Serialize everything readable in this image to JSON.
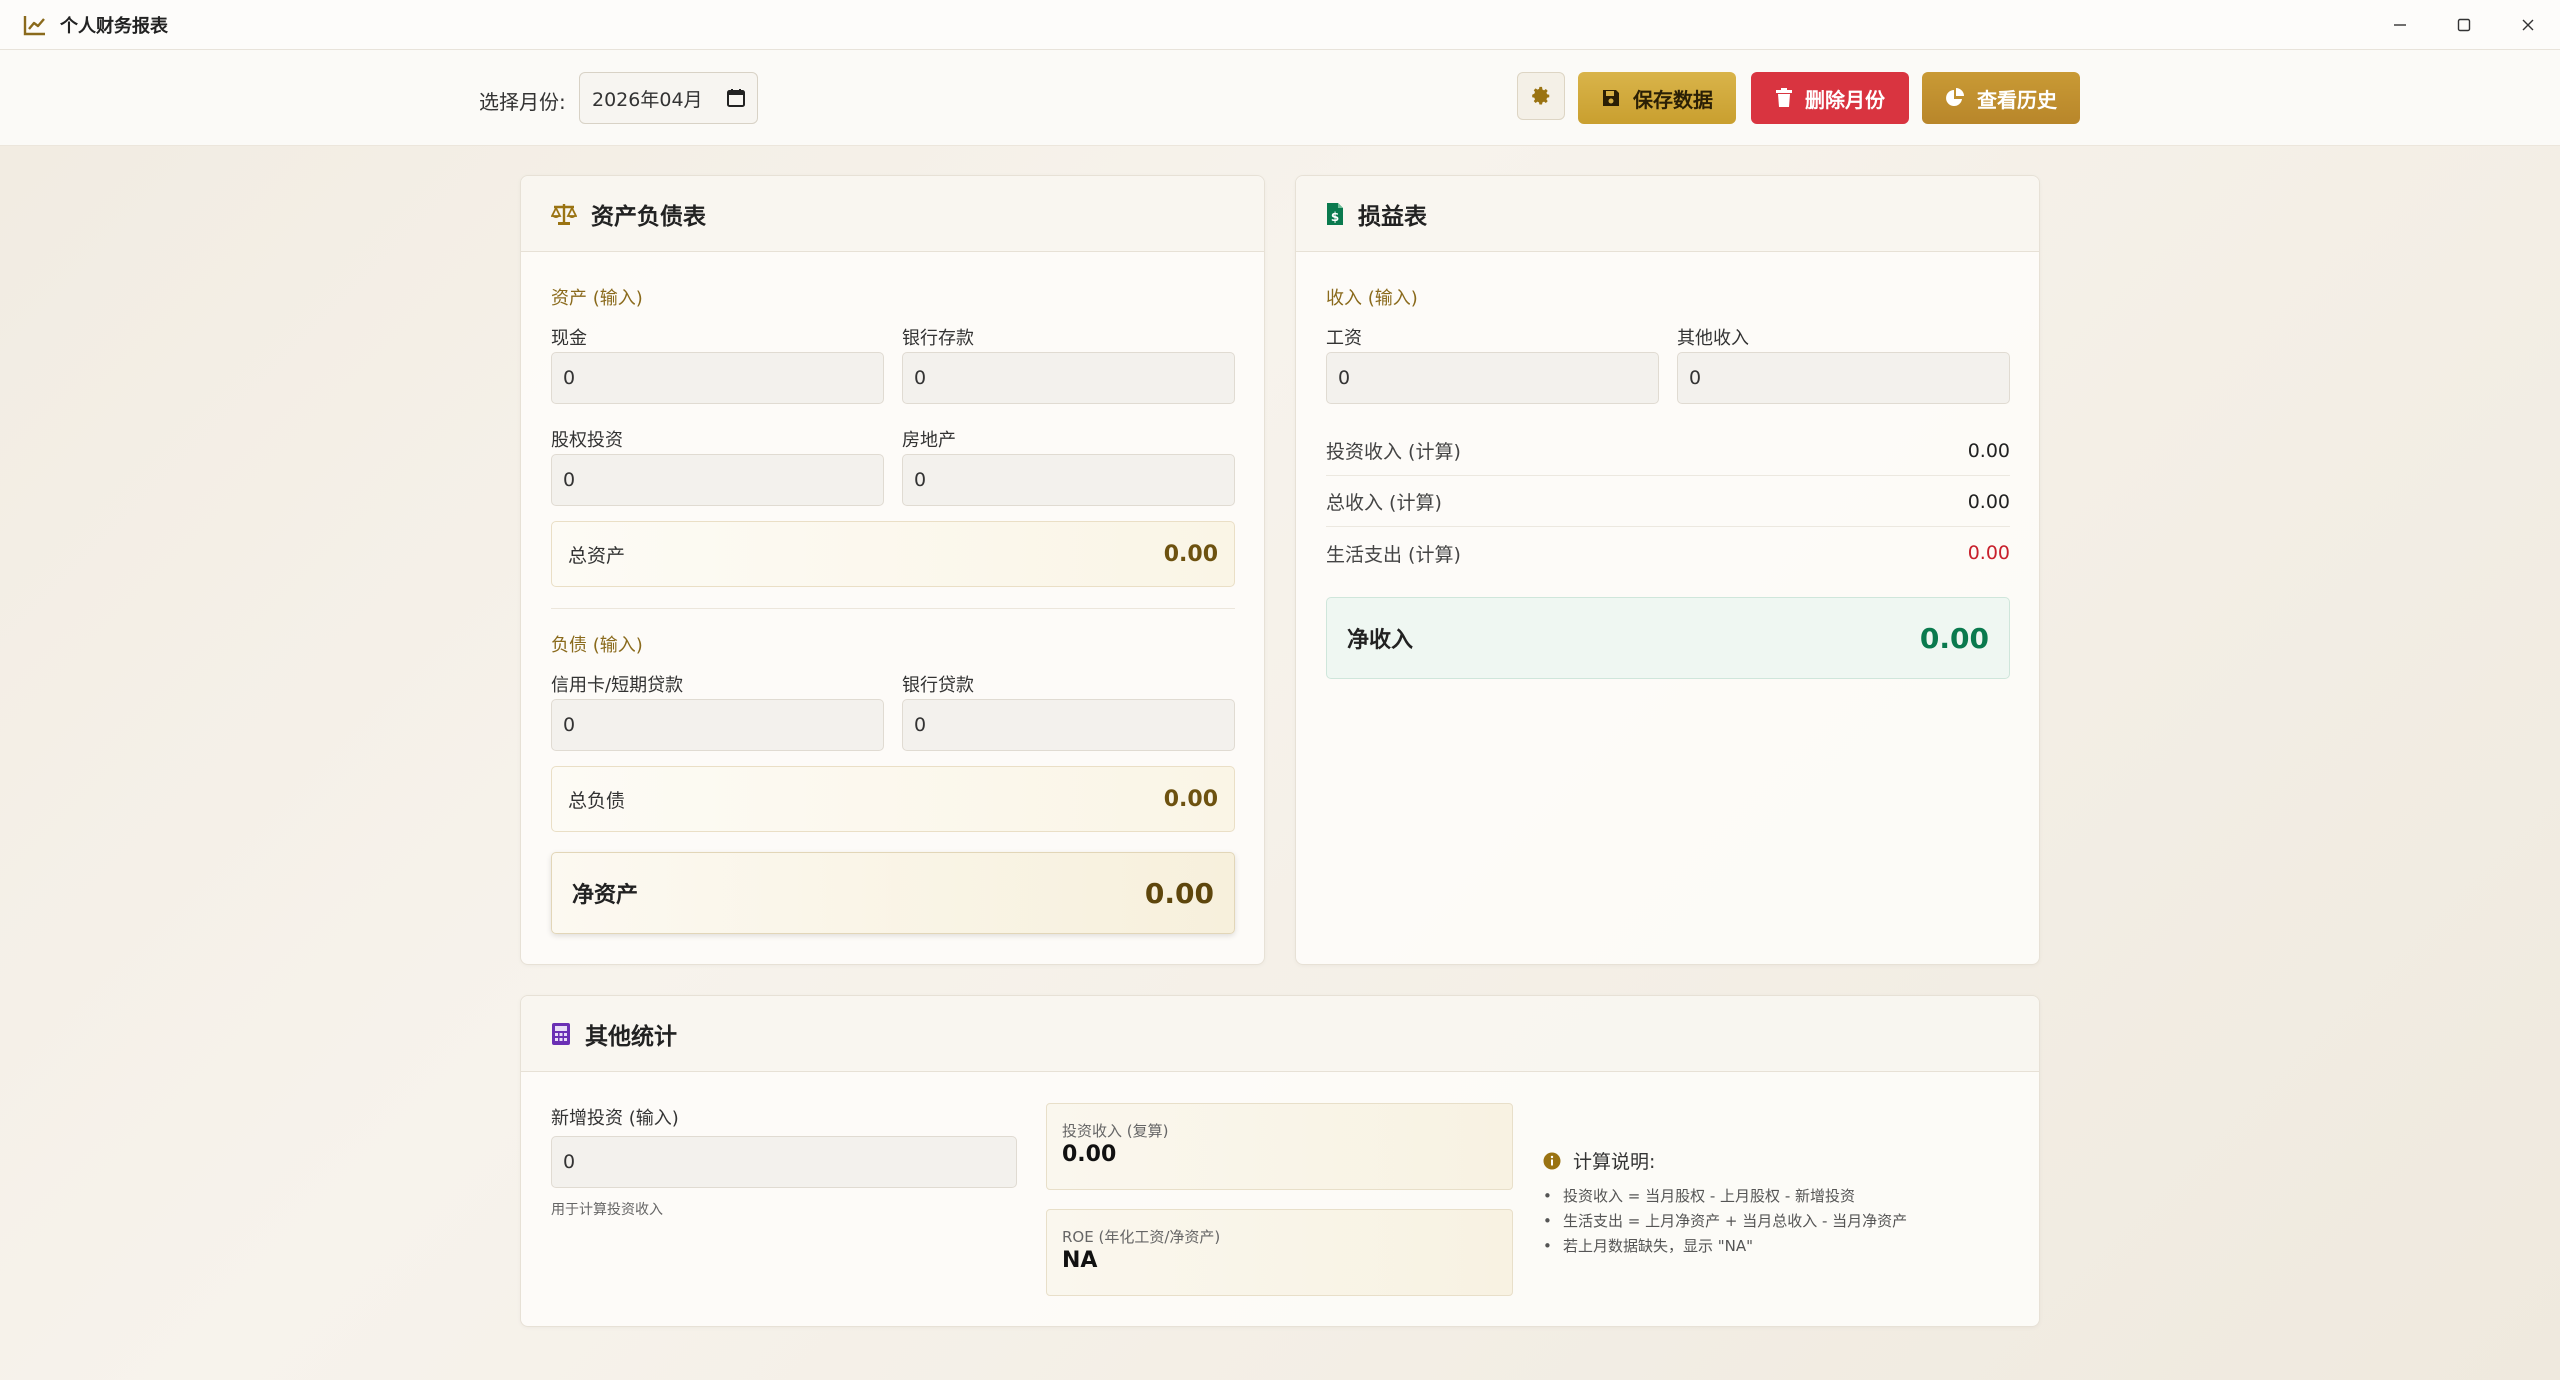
{
  "window": {
    "title": "个人财务报表"
  },
  "toolbar": {
    "month_label": "选择月份:",
    "month_value": "2026年04月",
    "save_label": "保存数据",
    "delete_label": "删除月份",
    "history_label": "查看历史"
  },
  "balance_sheet": {
    "title": "资产负债表",
    "assets_section": "资产 (输入)",
    "cash_label": "现金",
    "cash_value": "0",
    "deposit_label": "银行存款",
    "deposit_value": "0",
    "equity_label": "股权投资",
    "equity_value": "0",
    "realestate_label": "房地产",
    "realestate_value": "0",
    "total_assets_label": "总资产",
    "total_assets_value": "0.00",
    "liabilities_section": "负债 (输入)",
    "credit_label": "信用卡/短期贷款",
    "credit_value": "0",
    "loan_label": "银行贷款",
    "loan_value": "0",
    "total_liab_label": "总负债",
    "total_liab_value": "0.00",
    "net_assets_label": "净资产",
    "net_assets_value": "0.00"
  },
  "income_statement": {
    "title": "损益表",
    "income_section": "收入 (输入)",
    "salary_label": "工资",
    "salary_value": "0",
    "other_label": "其他收入",
    "other_value": "0",
    "invest_income_label": "投资收入 (计算)",
    "invest_income_value": "0.00",
    "total_income_label": "总收入 (计算)",
    "total_income_value": "0.00",
    "living_label": "生活支出 (计算)",
    "living_value": "0.00",
    "net_income_label": "净收入",
    "net_income_value": "0.00"
  },
  "other_stats": {
    "title": "其他统计",
    "new_invest_label": "新增投资 (输入)",
    "new_invest_value": "0",
    "new_invest_hint": "用于计算投资收入",
    "invest_income_label": "投资收入 (复算)",
    "invest_income_value": "0.00",
    "roe_label": "ROE (年化工资/净资产)",
    "roe_value": "NA",
    "notes_title": "计算说明:",
    "notes": [
      "投资收入 = 当月股权 - 上月股权 - 新增投资",
      "生活支出 = 上月净资产 + 当月总收入 - 当月净资产",
      "若上月数据缺失，显示 \"NA\""
    ]
  },
  "colors": {
    "gold": "#c99f2f",
    "danger": "#d93440",
    "green": "#0a7a4e",
    "red_text": "#c8202c",
    "purple": "#6a2fb4"
  }
}
